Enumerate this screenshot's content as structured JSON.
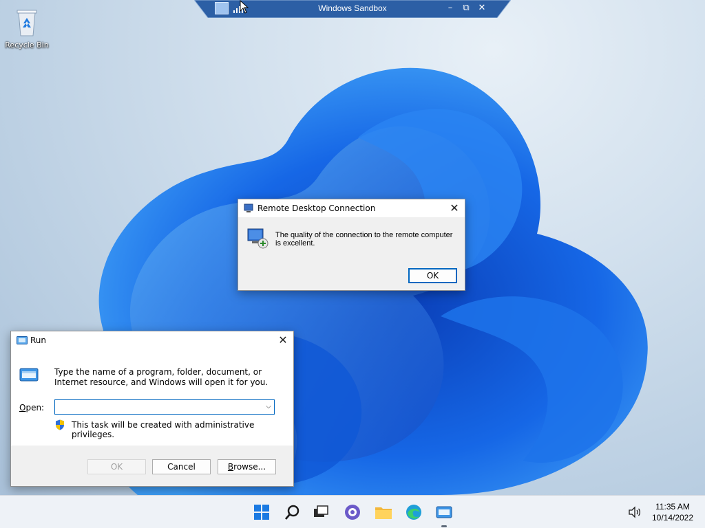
{
  "desktop": {
    "icons": [
      {
        "label": "Recycle Bin",
        "icon": "recycle-bin-icon"
      }
    ]
  },
  "sandbox_bar": {
    "title": "Windows Sandbox",
    "minimize_glyph": "–",
    "restore_glyph": "⧉",
    "close_glyph": "✕"
  },
  "rdc_dialog": {
    "title": "Remote Desktop Connection",
    "message": "The quality of the connection to the remote computer is excellent.",
    "ok_label": "OK",
    "close_glyph": "✕"
  },
  "run_dialog": {
    "title": "Run",
    "description": "Type the name of a program, folder, document, or Internet resource, and Windows will open it for you.",
    "open_label_accel": "O",
    "open_label_rest": "pen:",
    "open_value": "",
    "admin_note": "This task will be created with administrative privileges.",
    "ok_label": "OK",
    "cancel_label": "Cancel",
    "browse_label_accel": "B",
    "browse_label_rest": "rowse...",
    "close_glyph": "✕"
  },
  "taskbar": {
    "apps": [
      {
        "name": "start",
        "icon": "windows-start-icon"
      },
      {
        "name": "search",
        "icon": "search-icon"
      },
      {
        "name": "task-view",
        "icon": "task-view-icon"
      },
      {
        "name": "chat",
        "icon": "teams-chat-icon"
      },
      {
        "name": "file-explorer",
        "icon": "folder-icon"
      },
      {
        "name": "edge",
        "icon": "edge-browser-icon"
      },
      {
        "name": "run",
        "icon": "run-app-icon"
      }
    ],
    "clock": {
      "time": "11:35 AM",
      "date": "10/14/2022"
    }
  },
  "colors": {
    "accent": "#0067c0",
    "wallpaper_bloom": "#1a6de0",
    "sandbox_bar": "#2c5fa5"
  }
}
